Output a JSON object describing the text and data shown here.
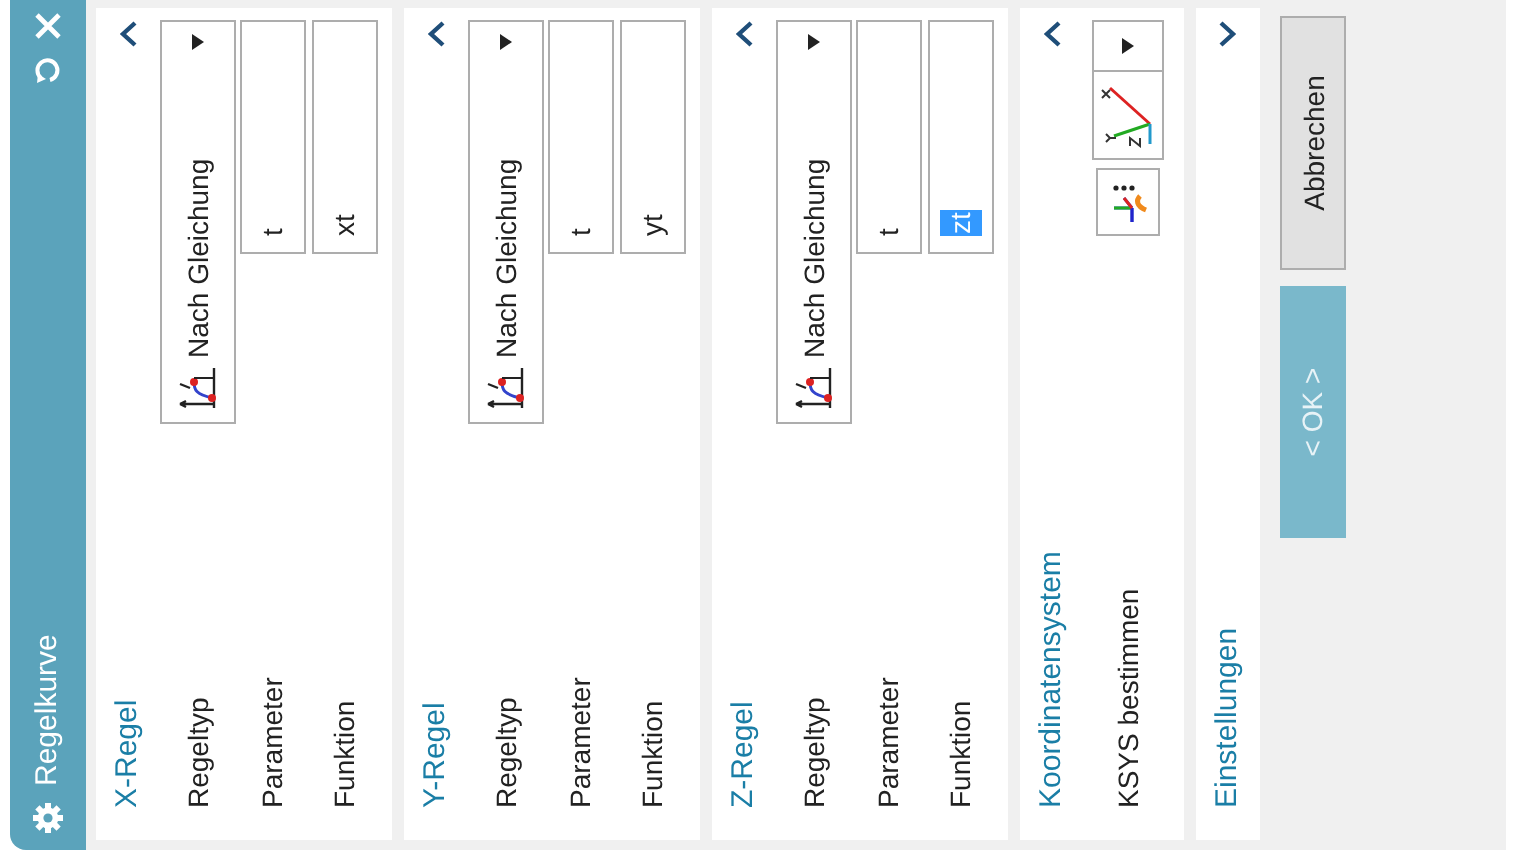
{
  "window": {
    "title": "Regelkurve"
  },
  "sections": [
    {
      "title": "X-Regel",
      "expanded": true,
      "rows": [
        {
          "label": "Regeltyp",
          "kind": "dropdown",
          "value": "Nach Gleichung"
        },
        {
          "label": "Parameter",
          "kind": "field",
          "value": "t",
          "highlighted": false
        },
        {
          "label": "Funktion",
          "kind": "field",
          "value": "xt",
          "highlighted": false
        }
      ]
    },
    {
      "title": "Y-Regel",
      "expanded": true,
      "rows": [
        {
          "label": "Regeltyp",
          "kind": "dropdown",
          "value": "Nach Gleichung"
        },
        {
          "label": "Parameter",
          "kind": "field",
          "value": "t",
          "highlighted": false
        },
        {
          "label": "Funktion",
          "kind": "field",
          "value": "yt",
          "highlighted": false
        }
      ]
    },
    {
      "title": "Z-Regel",
      "expanded": true,
      "rows": [
        {
          "label": "Regeltyp",
          "kind": "dropdown",
          "value": "Nach Gleichung"
        },
        {
          "label": "Parameter",
          "kind": "field",
          "value": "t",
          "highlighted": false
        },
        {
          "label": "Funktion",
          "kind": "field",
          "value": "zt",
          "highlighted": true
        }
      ]
    },
    {
      "title": "Koordinatensystem",
      "expanded": true,
      "rows": [
        {
          "label": "KSYS bestimmen",
          "kind": "csys"
        }
      ]
    },
    {
      "title": "Einstellungen",
      "expanded": false
    }
  ],
  "buttons": [
    {
      "label": "< OK >",
      "kind": "primary"
    },
    {
      "label": "Abbrechen",
      "kind": "secondary"
    }
  ]
}
